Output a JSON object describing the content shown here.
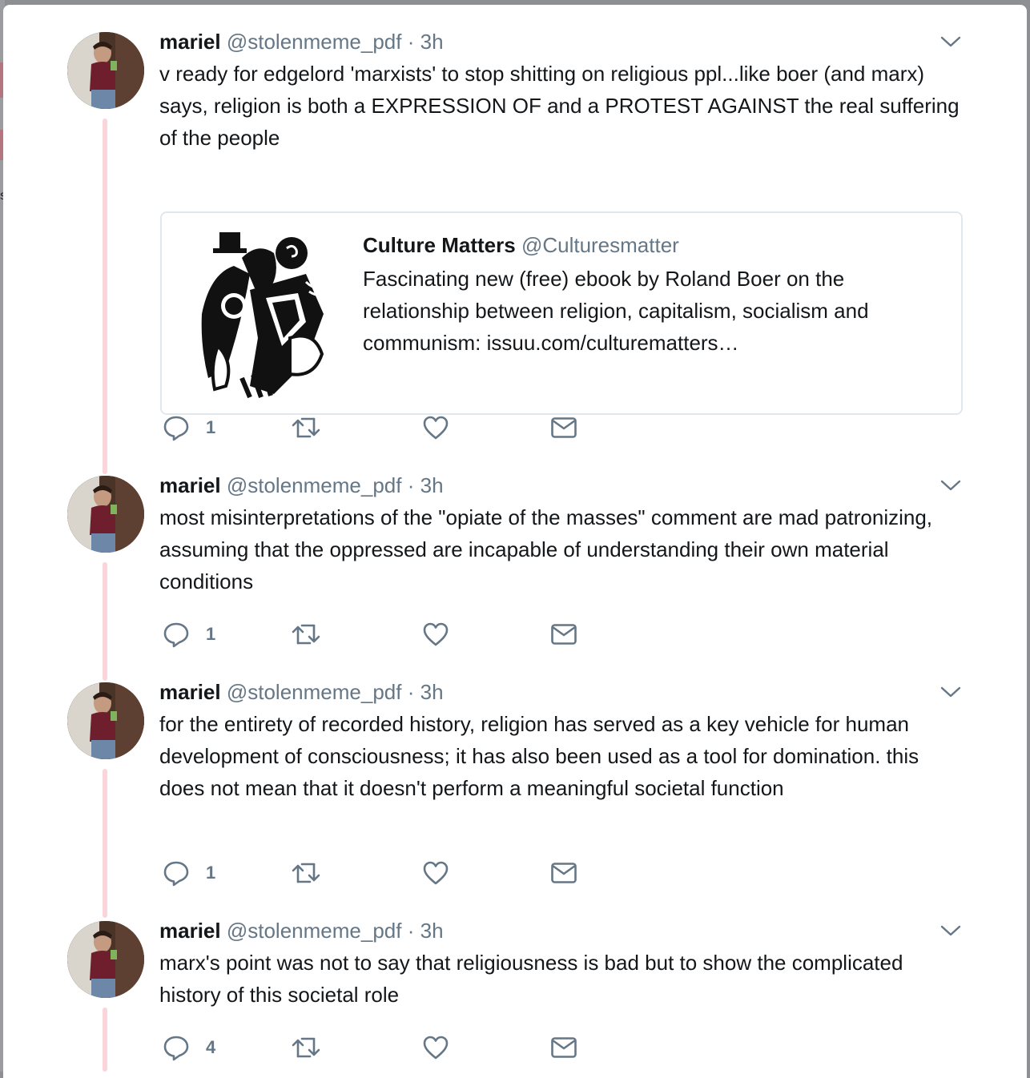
{
  "thread": {
    "tweets": [
      {
        "name": "mariel",
        "handle": "@stolenmeme_pdf",
        "separator": "·",
        "time": "3h",
        "text": "v ready for edgelord 'marxists' to stop shitting on religious ppl...like boer (and marx) says, religion is both a EXPRESSION OF and a PROTEST AGAINST the real suffering of the people",
        "reply_count": "1",
        "quote": {
          "name": "Culture Matters",
          "handle": "@Culturesmatter",
          "text": "Fascinating new (free) ebook by Roland Boer on the relationship between religion, capitalism, socialism and communism: issuu.com/culturematters…"
        }
      },
      {
        "name": "mariel",
        "handle": "@stolenmeme_pdf",
        "separator": "·",
        "time": "3h",
        "text": "most misinterpretations of the \"opiate of the masses\" comment are mad patronizing, assuming that the oppressed are incapable of understanding their own material conditions",
        "reply_count": "1"
      },
      {
        "name": "mariel",
        "handle": "@stolenmeme_pdf",
        "separator": "·",
        "time": "3h",
        "text": "for the entirety of recorded history, religion has served as a key vehicle for human development of consciousness; it has also been used as a tool for domination. this does not mean that it doesn't perform a meaningful societal function",
        "reply_count": "1"
      },
      {
        "name": "mariel",
        "handle": "@stolenmeme_pdf",
        "separator": "·",
        "time": "3h",
        "text": "marx's point was not to say that religiousness is bad but to show the complicated history of this societal role",
        "reply_count": "4"
      }
    ]
  },
  "icons": {
    "reply": "reply-icon",
    "retweet": "retweet-icon",
    "like": "heart-icon",
    "dm": "envelope-icon",
    "caret": "chevron-down-icon"
  },
  "colors": {
    "text": "#14171a",
    "secondary": "#657786",
    "thread_line": "#fbd5dc",
    "border": "#e1e8ed"
  }
}
